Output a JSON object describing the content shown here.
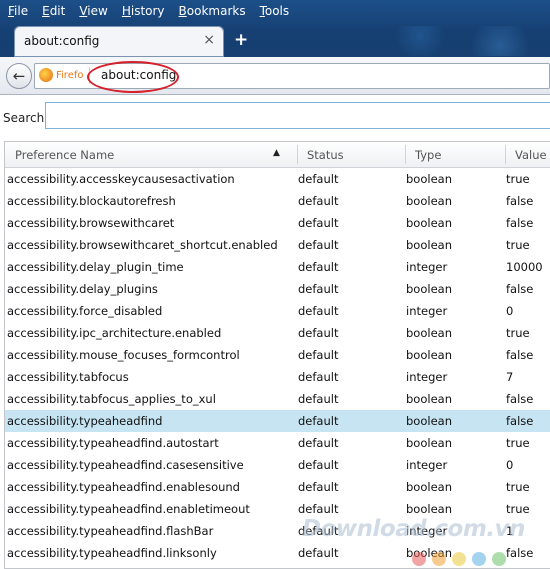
{
  "menu": [
    {
      "accel": "F",
      "rest": "ile"
    },
    {
      "accel": "E",
      "rest": "dit"
    },
    {
      "accel": "V",
      "rest": "iew"
    },
    {
      "accel": "H",
      "rest": "istory"
    },
    {
      "accel": "B",
      "rest": "ookmarks"
    },
    {
      "accel": "T",
      "rest": "ools"
    }
  ],
  "tab": {
    "title": "about:config",
    "close": "×",
    "new_tab": "+"
  },
  "navbar": {
    "back": "←",
    "identity": "Firefo",
    "url": "about:config"
  },
  "search": {
    "label": "Search:",
    "value": ""
  },
  "table": {
    "columns": [
      "Preference Name",
      "Status",
      "Type",
      "Value"
    ],
    "sort_indicator": "▲",
    "selected_row": 11,
    "rows": [
      [
        "accessibility.accesskeycausesactivation",
        "default",
        "boolean",
        "true"
      ],
      [
        "accessibility.blockautorefresh",
        "default",
        "boolean",
        "false"
      ],
      [
        "accessibility.browsewithcaret",
        "default",
        "boolean",
        "false"
      ],
      [
        "accessibility.browsewithcaret_shortcut.enabled",
        "default",
        "boolean",
        "true"
      ],
      [
        "accessibility.delay_plugin_time",
        "default",
        "integer",
        "10000"
      ],
      [
        "accessibility.delay_plugins",
        "default",
        "boolean",
        "false"
      ],
      [
        "accessibility.force_disabled",
        "default",
        "integer",
        "0"
      ],
      [
        "accessibility.ipc_architecture.enabled",
        "default",
        "boolean",
        "true"
      ],
      [
        "accessibility.mouse_focuses_formcontrol",
        "default",
        "boolean",
        "false"
      ],
      [
        "accessibility.tabfocus",
        "default",
        "integer",
        "7"
      ],
      [
        "accessibility.tabfocus_applies_to_xul",
        "default",
        "boolean",
        "false"
      ],
      [
        "accessibility.typeaheadfind",
        "default",
        "boolean",
        "false"
      ],
      [
        "accessibility.typeaheadfind.autostart",
        "default",
        "boolean",
        "true"
      ],
      [
        "accessibility.typeaheadfind.casesensitive",
        "default",
        "integer",
        "0"
      ],
      [
        "accessibility.typeaheadfind.enablesound",
        "default",
        "boolean",
        "true"
      ],
      [
        "accessibility.typeaheadfind.enabletimeout",
        "default",
        "boolean",
        "true"
      ],
      [
        "accessibility.typeaheadfind.flashBar",
        "default",
        "integer",
        "1"
      ],
      [
        "accessibility.typeaheadfind.linksonly",
        "default",
        "boolean",
        "false"
      ]
    ]
  },
  "watermark": {
    "text": "Download.com.vn",
    "dot_colors": [
      "#e85a5a",
      "#f0a030",
      "#e8c83a",
      "#5aaee0",
      "#6ac06a"
    ]
  }
}
